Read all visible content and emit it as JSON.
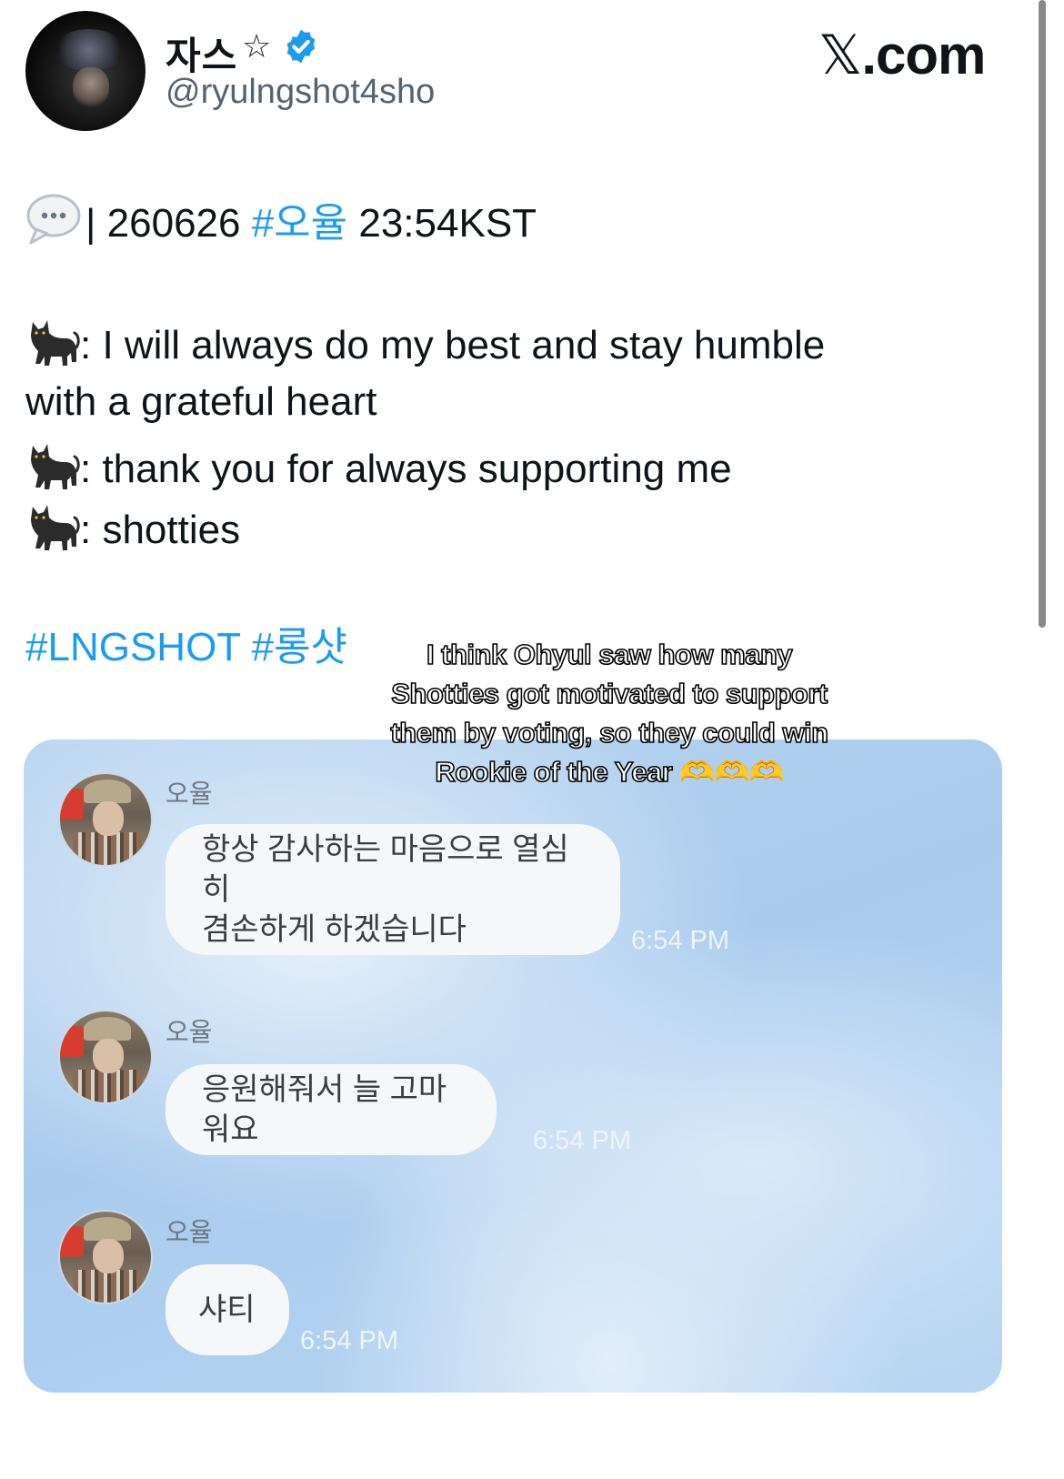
{
  "header": {
    "display_name": "자스",
    "star_symbol": "☆",
    "handle": "@ryulngshot4sho",
    "site_x": "𝕏",
    "site_suffix": ".com",
    "verified_color": "#1d9bf0"
  },
  "tweet": {
    "line1": {
      "prefix": "| 260626 ",
      "hashtag": "#오율",
      "suffix": " 23:54KST"
    },
    "quote1a": ": I will always do my best and stay humble",
    "quote1b": "with a grateful heart",
    "quote2": ": thank you for always supporting me",
    "quote3": ": shotties",
    "hashtags": [
      "#LNGSHOT",
      "#롱샷"
    ],
    "link_color": "#1d9bf0"
  },
  "caption": {
    "lines": [
      "I think Ohyul saw how many",
      "Shotties got motivated to support",
      "them by voting, so they could win",
      "Rookie of the Year 🫶🫶🫶"
    ]
  },
  "chat": {
    "messages": [
      {
        "name": "오율",
        "text_line1": "항상 감사하는 마음으로 열심히",
        "text_line2": "겸손하게 하겠습니다",
        "time": "6:54 PM"
      },
      {
        "name": "오율",
        "text_line1": "응원해줘서 늘 고마워요",
        "time": "6:54 PM"
      },
      {
        "name": "오율",
        "text_line1": "샤티",
        "time": "6:54 PM"
      }
    ]
  }
}
